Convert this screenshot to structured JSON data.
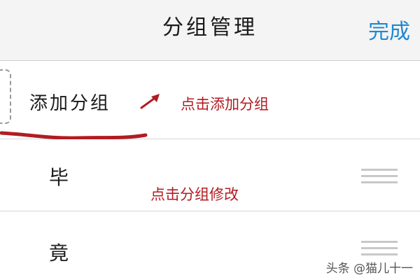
{
  "header": {
    "title": "分组管理",
    "done_label": "完成"
  },
  "add_row": {
    "label": "添加分组"
  },
  "annotations": {
    "add_hint": "点击添加分组",
    "edit_hint": "点击分组修改",
    "color": "#b11c22"
  },
  "groups": [
    {
      "name": "毕"
    },
    {
      "name": "竟"
    }
  ],
  "watermark": "头条 @猫儿十一",
  "colors": {
    "accent": "#1e88d4",
    "annotation": "#b11c22"
  }
}
